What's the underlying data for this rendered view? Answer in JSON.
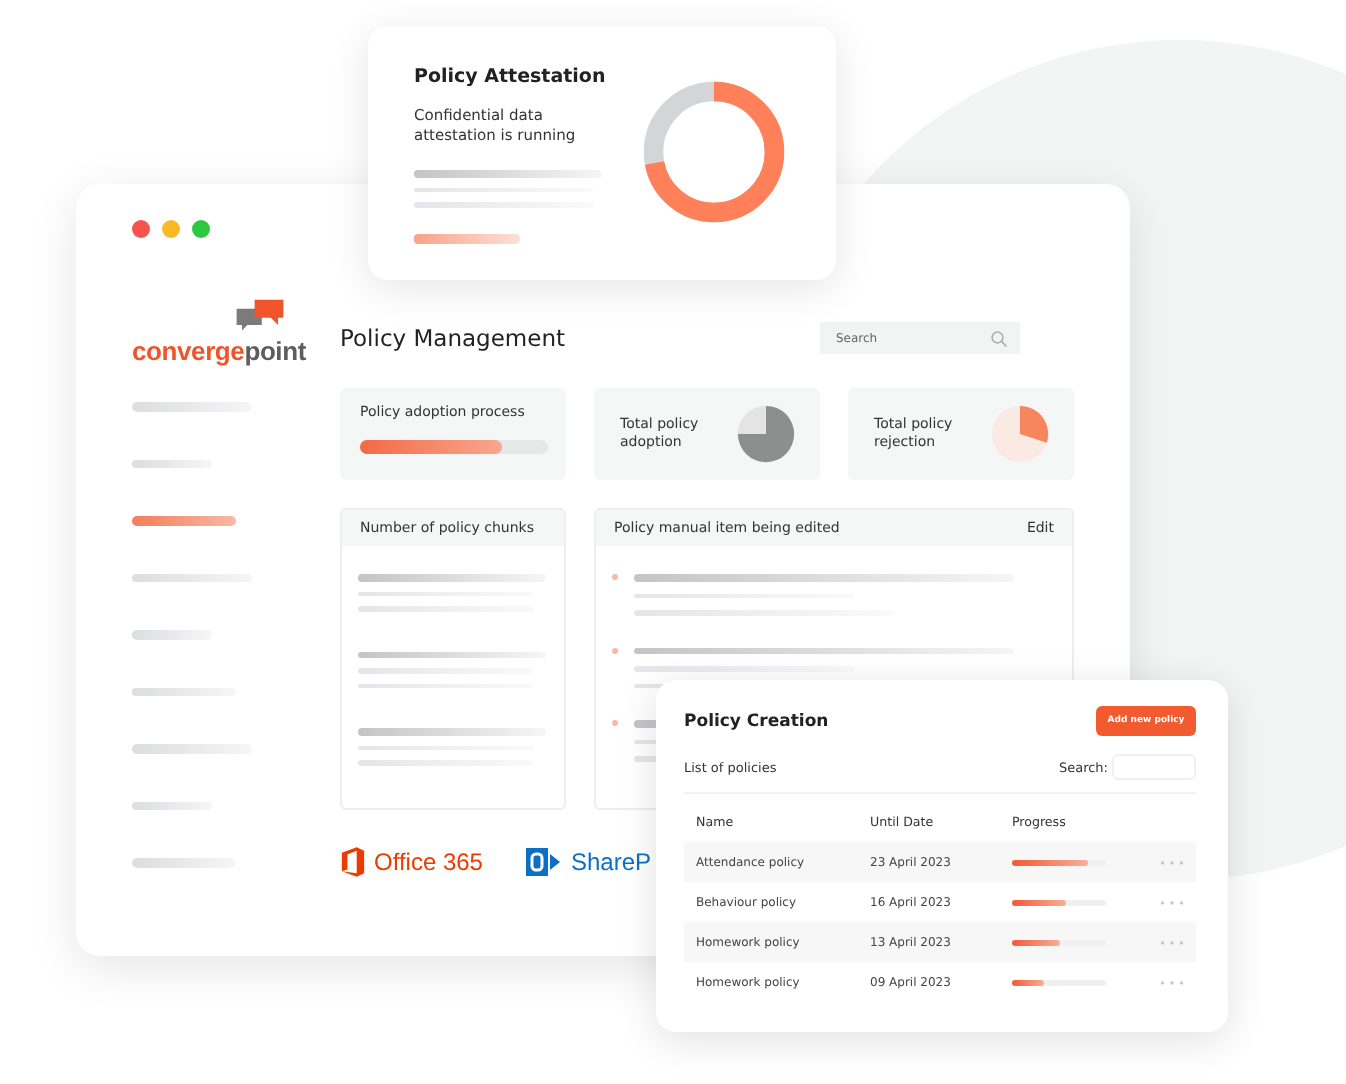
{
  "attestation": {
    "title": "Policy Attestation",
    "description": "Confidential data attestation is running"
  },
  "logo": {
    "accent": "converge",
    "rest": "point"
  },
  "sidebar": {
    "items": [
      {
        "selected": false
      },
      {
        "selected": false
      },
      {
        "selected": true
      },
      {
        "selected": false
      },
      {
        "selected": false
      },
      {
        "selected": false
      },
      {
        "selected": false
      },
      {
        "selected": false
      },
      {
        "selected": false
      }
    ]
  },
  "header": {
    "title": "Policy Management",
    "search_placeholder": "Search"
  },
  "stats": [
    {
      "kind": "bar",
      "label": "Policy adoption process",
      "level": 0.75
    },
    {
      "kind": "pie",
      "label": "Total policy adoption"
    },
    {
      "kind": "pie-accent",
      "label": "Total policy rejection"
    }
  ],
  "chunks": {
    "title": "Number of policy chunks"
  },
  "edited": {
    "title": "Policy manual item being edited",
    "action": "Edit"
  },
  "integrations": [
    {
      "kind": "office",
      "label": "Office 365"
    },
    {
      "kind": "sharepoint",
      "label": "ShareP"
    }
  ],
  "creation": {
    "title": "Policy Creation",
    "button": "Add new policy",
    "list_label": "List of policies",
    "search_label": "Search:",
    "columns": [
      "Name",
      "Until Date",
      "Progress"
    ],
    "rows": [
      {
        "name": "Attendance policy",
        "date": "23 April 2023",
        "level": 0.8
      },
      {
        "name": "Behaviour policy",
        "date": "16 April 2023",
        "level": 0.58
      },
      {
        "name": "Homework policy",
        "date": "13 April 2023",
        "level": 0.5
      },
      {
        "name": "Homework policy",
        "date": "09 April 2023",
        "level": 0.35
      }
    ]
  }
}
